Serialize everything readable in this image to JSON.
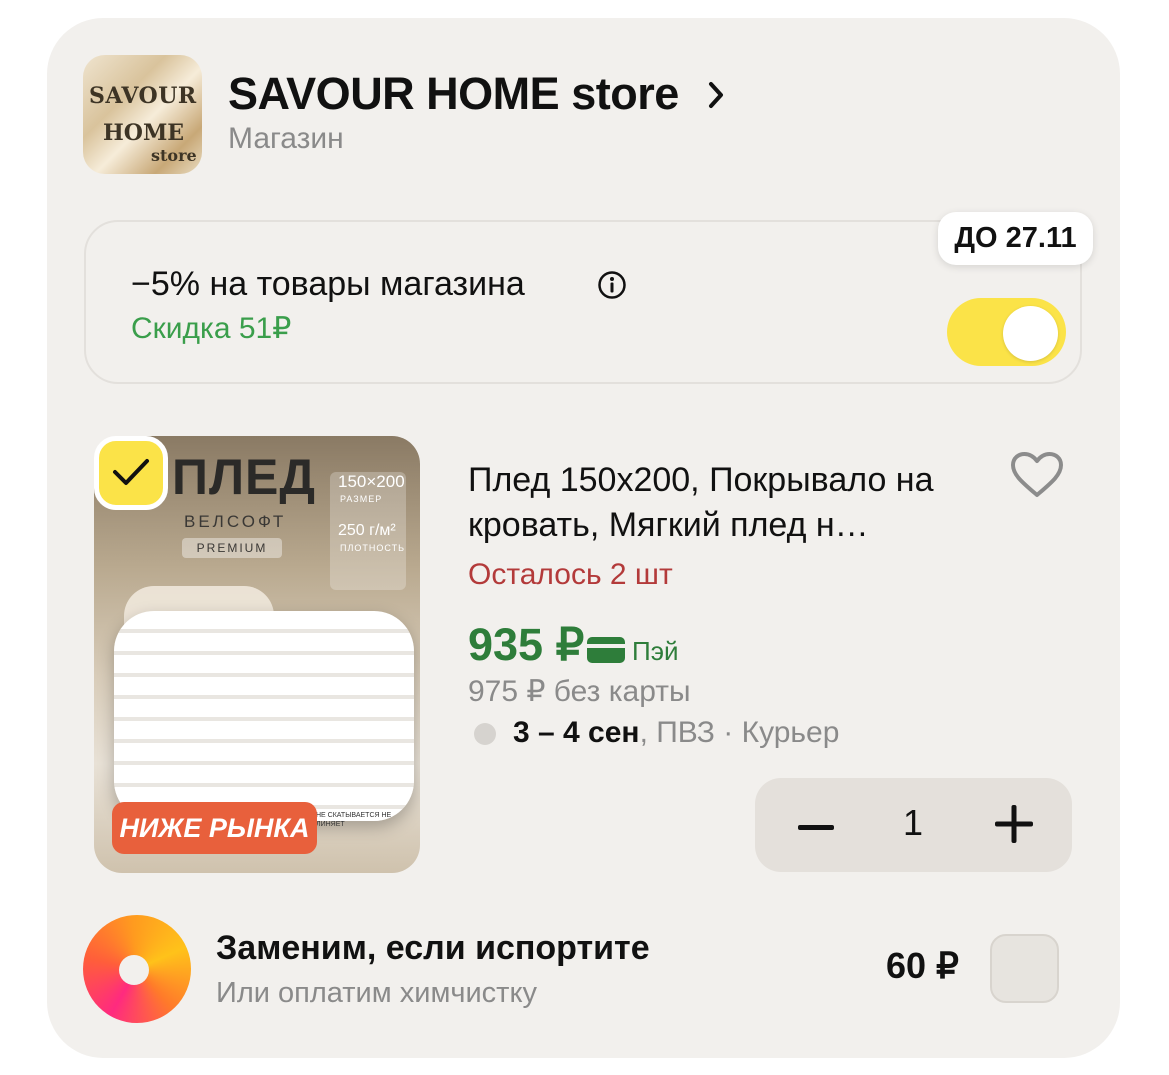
{
  "store": {
    "logo_lines": [
      "SAVOUR",
      "HOME",
      "store"
    ],
    "name": "SAVOUR HOME store",
    "type_label": "Магазин"
  },
  "promo": {
    "title": "−5% на товары магазина",
    "discount": "Скидка 51₽",
    "badge": "ДО 27.11",
    "toggle_on": true
  },
  "product": {
    "image": {
      "title": "ПЛЕД",
      "subtitle": "ВЕЛСОФТ",
      "tag": "PREMIUM",
      "size_value": "150×200",
      "size_label": "РАЗМЕР",
      "density_value": "250 г/м²",
      "density_label": "ПЛОТНОСТЬ",
      "note": "НЕ СКАТЫВАЕТСЯ НЕ ЛИНЯЕТ",
      "badge": "НИЖЕ РЫНКА"
    },
    "selected": true,
    "name": "Плед 150х200, Покрывало на кровать, Мягкий плед н…",
    "stock": "Осталось 2 шт",
    "price": "935 ₽",
    "pay_label": "Пэй",
    "old_price": "975 ₽  без карты",
    "delivery_date": "3 – 4 сен",
    "delivery_methods": ", ПВЗ · Курьер",
    "quantity": "1"
  },
  "insurance": {
    "title": "Заменим, если испортите",
    "subtitle": "Или оплатим химчистку",
    "price": "60 ₽"
  },
  "colors": {
    "accent_yellow": "#fbe348",
    "price_green": "#2e7d3a",
    "discount_green": "#3a9e4b",
    "stock_red": "#b33a3a"
  }
}
